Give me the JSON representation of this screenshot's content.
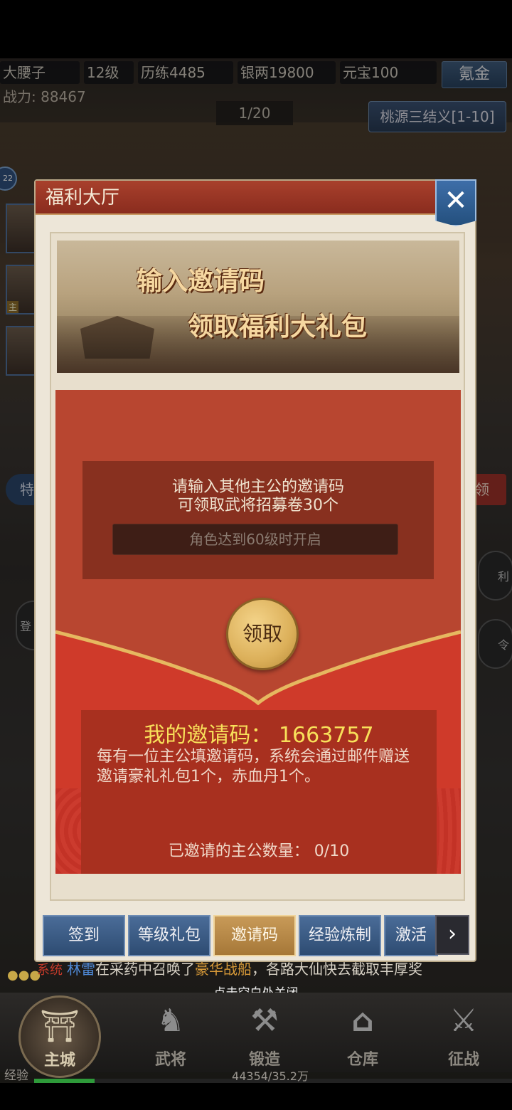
{
  "player": {
    "name": "大腰子",
    "level": "12级",
    "experience_points": "历练4485",
    "silver": "银两19800",
    "yuanbao": "元宝100",
    "power": "战力: 88467",
    "recharge_label": "氪金"
  },
  "stage": {
    "progress": "1/20",
    "name": "桃源三结义[1-10]"
  },
  "side": {
    "badge": "22",
    "portrait_tag": "主",
    "left_pill": "特",
    "right_pill": "领",
    "round_left_1": "登",
    "round_right_1": "利",
    "round_right_2": "令"
  },
  "modal": {
    "title": "福利大厅",
    "banner_line1": "输入邀请码",
    "banner_line2": "领取福利大礼包",
    "input_tip_line1": "请输入其他主公的邀请码",
    "input_tip_line2": "可领取武将招募卷30个",
    "input_placeholder": "角色达到60级时开启",
    "claim_label": "领取",
    "my_code_line": "我的邀请码：  1663757",
    "invite_desc": "每有一位主公填邀请码，系统会通过邮件赠送邀请豪礼礼包1个，赤血丹1个。",
    "invited_count": "已邀请的主公数量：  0/10",
    "tabs": [
      {
        "label": "签到",
        "active": false
      },
      {
        "label": "等级礼包",
        "active": false
      },
      {
        "label": "邀请码",
        "active": true
      },
      {
        "label": "经验炼制",
        "active": false
      },
      {
        "label": "激活",
        "active": false
      }
    ]
  },
  "chat": {
    "tag": "系统",
    "player_name": "林雷",
    "text_before": "在采药中召唤了",
    "item": "豪华战船",
    "text_after": "，各路大仙快去截取丰厚奖"
  },
  "close_hint": "点击空白处关闭",
  "nav": {
    "main": "主城",
    "generals": "武将",
    "forge": "锻造",
    "warehouse": "仓库",
    "campaign": "征战"
  },
  "exp": {
    "label": "经验",
    "value": "44354/35.2万",
    "progress_fraction": 0.126
  },
  "colors": {
    "modal_header": "#a8402c",
    "envelope_red": "#c24a32",
    "gold_text": "#f8e05a",
    "tab_active": "#c89a58",
    "tab_inactive": "#4a6c98"
  }
}
